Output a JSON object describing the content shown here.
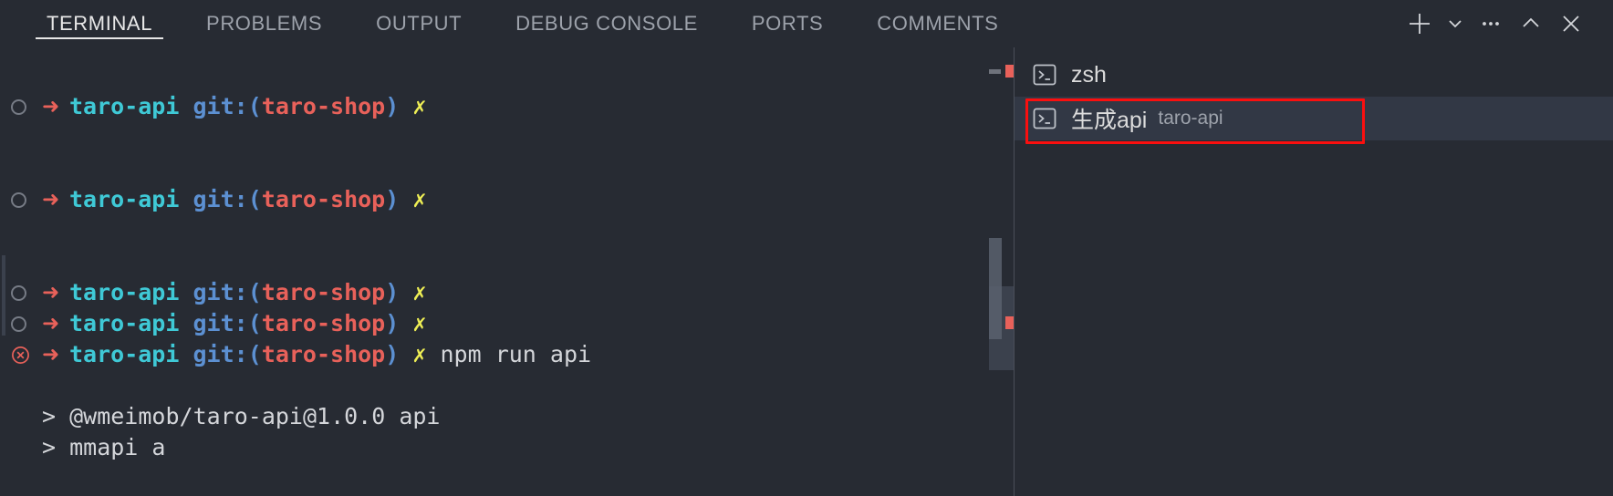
{
  "panel": {
    "tabs": [
      {
        "label": "TERMINAL",
        "active": true
      },
      {
        "label": "PROBLEMS",
        "active": false
      },
      {
        "label": "OUTPUT",
        "active": false
      },
      {
        "label": "DEBUG CONSOLE",
        "active": false
      },
      {
        "label": "PORTS",
        "active": false
      },
      {
        "label": "COMMENTS",
        "active": false
      }
    ],
    "actions": [
      {
        "name": "new-terminal-button",
        "icon": "plus-icon"
      },
      {
        "name": "terminal-dropdown-button",
        "icon": "chevron-down-icon"
      },
      {
        "name": "views-and-more-actions-button",
        "icon": "ellipsis-icon"
      },
      {
        "name": "maximize-panel-button",
        "icon": "chevron-up-icon"
      },
      {
        "name": "close-panel-button",
        "icon": "close-icon"
      }
    ]
  },
  "terminal": {
    "prompt": {
      "dir": "taro-api",
      "git_prefix": "git:",
      "paren_open": "(",
      "branch": "taro-shop",
      "paren_close": ")",
      "status": "✗",
      "arrow": "➜"
    },
    "lines": [
      {
        "type": "prompt",
        "status_icon": "circle-ok",
        "command": ""
      },
      {
        "type": "blank"
      },
      {
        "type": "blank"
      },
      {
        "type": "prompt",
        "status_icon": "circle-ok",
        "command": ""
      },
      {
        "type": "blank"
      },
      {
        "type": "blank"
      },
      {
        "type": "prompt",
        "status_icon": "circle-ok",
        "command": ""
      },
      {
        "type": "prompt",
        "status_icon": "circle-ok",
        "command": ""
      },
      {
        "type": "prompt",
        "status_icon": "circle-error",
        "command": "npm run api"
      },
      {
        "type": "blank"
      },
      {
        "type": "output",
        "text": "> @wmeimob/taro-api@1.0.0 api"
      },
      {
        "type": "output",
        "text": "> mmapi a"
      }
    ]
  },
  "terminal_list": {
    "items": [
      {
        "icon": "terminal-icon",
        "title": "zsh",
        "subtitle": "",
        "selected": false
      },
      {
        "icon": "terminal-icon",
        "title": "生成api",
        "subtitle": "taro-api",
        "selected": true
      }
    ]
  },
  "colors": {
    "background": "#272b33",
    "selected_row": "#323845",
    "accent_red": "#e8615a",
    "annotation_red": "#fb0f0f",
    "cyan": "#3fc9d6",
    "blue": "#5c90d2",
    "yellow": "#eeee55",
    "text": "#d4d6da",
    "muted": "#9da2ab"
  }
}
